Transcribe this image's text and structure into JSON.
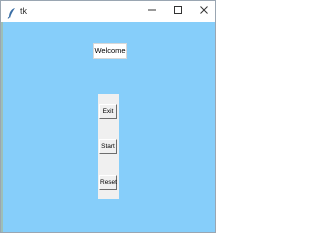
{
  "window": {
    "title": "tk",
    "minimize_icon": "minimize-icon",
    "maximize_icon": "maximize-icon",
    "close_icon": "close-icon",
    "app_icon": "feather-icon"
  },
  "colors": {
    "client_background": "#86cefa",
    "button_face": "#f0f0f0",
    "label_background": "#ffffff"
  },
  "main": {
    "welcome_label": "Welcome",
    "buttons": {
      "exit": "Exit",
      "start": "Start",
      "reset": "Reset"
    }
  }
}
